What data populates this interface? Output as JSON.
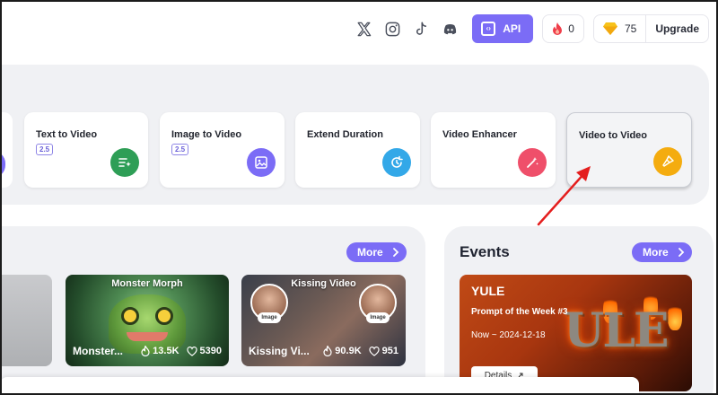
{
  "topbar": {
    "socials": [
      "x-icon",
      "instagram-icon",
      "tiktok-icon",
      "discord-icon"
    ],
    "api_label": "API",
    "fire_count": "0",
    "gem_count": "75",
    "upgrade_label": "Upgrade"
  },
  "tools": [
    {
      "title": "Text to Video",
      "badge": "2.5",
      "icon": "text-sparkle-icon",
      "color": "#2e9e56"
    },
    {
      "title": "Image to Video",
      "badge": "2.5",
      "icon": "image-icon",
      "color": "#7b6cf6"
    },
    {
      "title": "Extend Duration",
      "badge": "",
      "icon": "timer-refresh-icon",
      "color": "#33a8e8"
    },
    {
      "title": "Video Enhancer",
      "badge": "",
      "icon": "magic-wand-icon",
      "color": "#ef4f6a"
    },
    {
      "title": "Video to Video",
      "badge": "",
      "icon": "brush-icon",
      "color": "#f4ac0f"
    }
  ],
  "gallery": {
    "more_label": "More",
    "items": [
      {
        "caption": "Monster Morph",
        "name": "Monster...",
        "views": "13.5K",
        "likes": "5390"
      },
      {
        "caption": "Kissing Video",
        "name": "Kissing Vi...",
        "views": "90.9K",
        "likes": "951",
        "tag": "Image"
      }
    ]
  },
  "events": {
    "title": "Events",
    "more_label": "More",
    "card": {
      "title": "YULE",
      "subtitle": "Prompt of the Week #3",
      "date": "Now ~ 2024-12-18",
      "button": "Details",
      "art_text": "ULE"
    }
  }
}
